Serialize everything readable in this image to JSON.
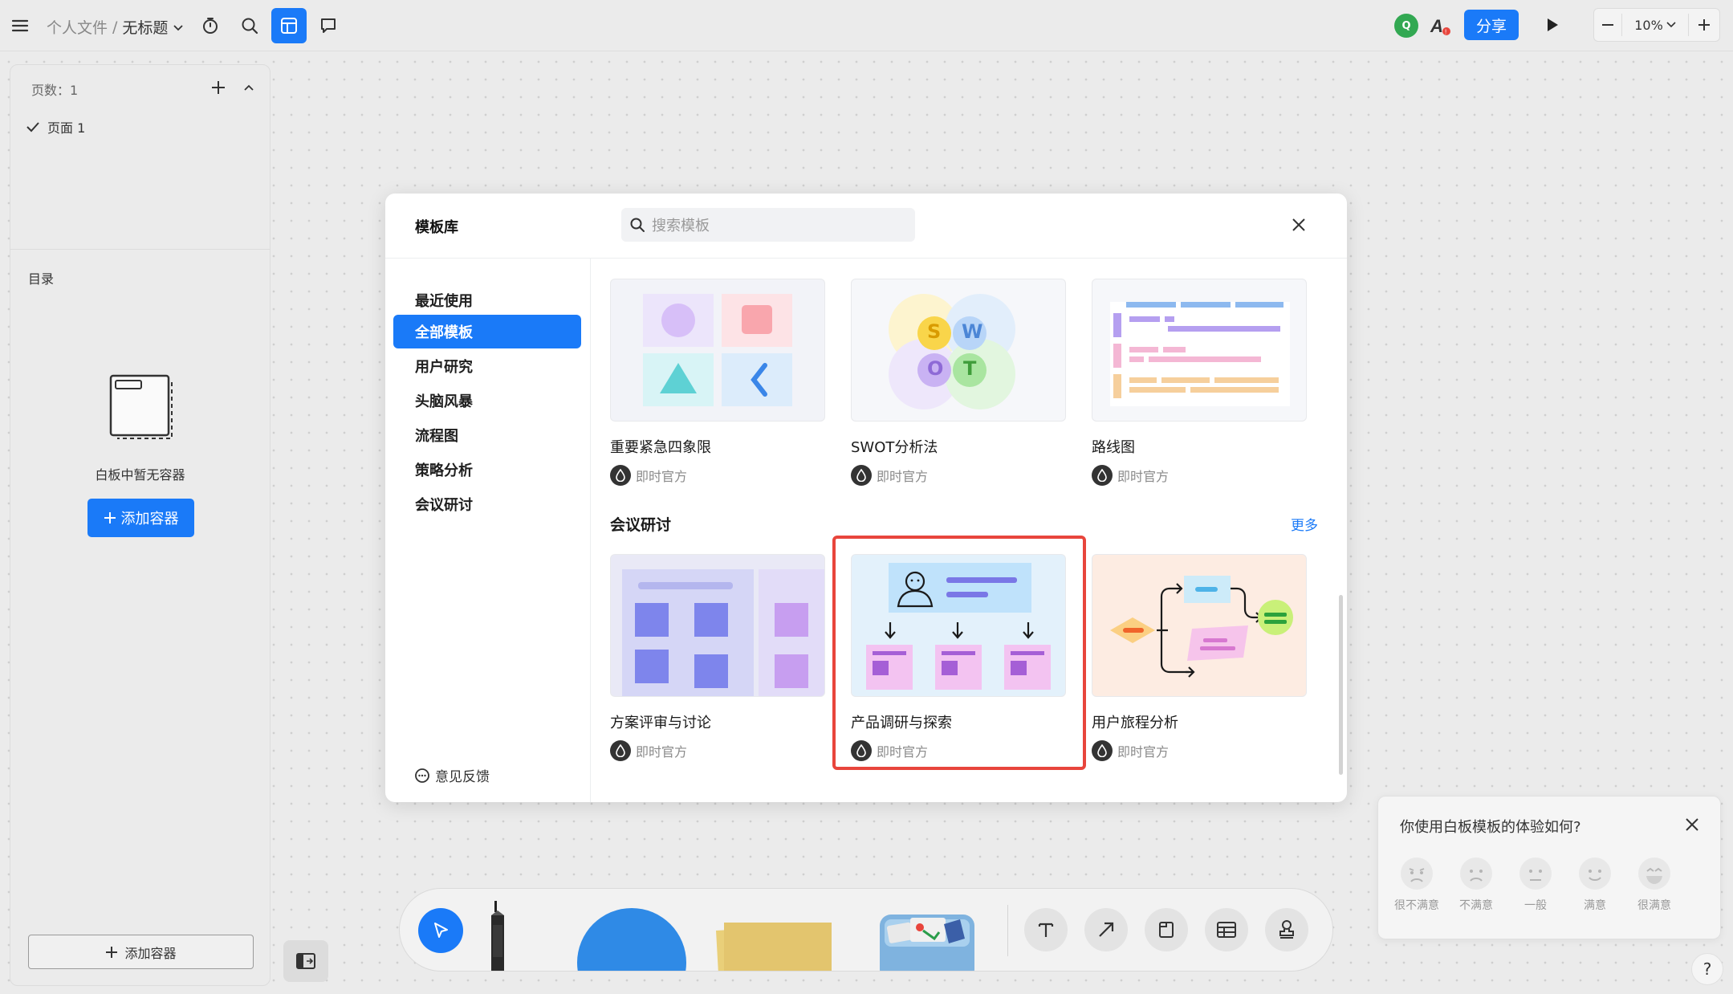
{
  "topbar": {
    "breadcrumb_parent": "个人文件",
    "breadcrumb_sep": "/",
    "breadcrumb_current": "无标题",
    "avatar_initial": "Q",
    "share_label": "分享",
    "zoom_level": "10%"
  },
  "left_panel": {
    "pages_label": "页数：1",
    "page_item": "页面 1",
    "toc_label": "目录",
    "empty_text": "白板中暂无容器",
    "add_container_primary": "添加容器",
    "add_container_bottom": "添加容器"
  },
  "modal": {
    "title": "模板库",
    "search_placeholder": "搜索模板",
    "categories": [
      "最近使用",
      "全部模板",
      "用户研究",
      "头脑风暴",
      "流程图",
      "策略分析",
      "会议研讨"
    ],
    "active_category": "全部模板",
    "feedback_label": "意见反馈",
    "section_title": "会议研讨",
    "more_label": "更多",
    "templates_row1": [
      {
        "name": "重要紧急四象限",
        "author": "即时官方"
      },
      {
        "name": "SWOT分析法",
        "author": "即时官方"
      },
      {
        "name": "路线图",
        "author": "即时官方"
      }
    ],
    "templates_row2": [
      {
        "name": "方案评审与讨论",
        "author": "即时官方"
      },
      {
        "name": "产品调研与探索",
        "author": "即时官方"
      },
      {
        "name": "用户旅程分析",
        "author": "即时官方"
      }
    ],
    "swot_letters": [
      "S",
      "W",
      "O",
      "T"
    ]
  },
  "survey": {
    "question": "你使用白板模板的体验如何?",
    "options": [
      "很不满意",
      "不满意",
      "一般",
      "满意",
      "很满意"
    ]
  },
  "help_label": "?",
  "colors": {
    "accent": "#1a7af8",
    "highlight": "#e8453c"
  }
}
